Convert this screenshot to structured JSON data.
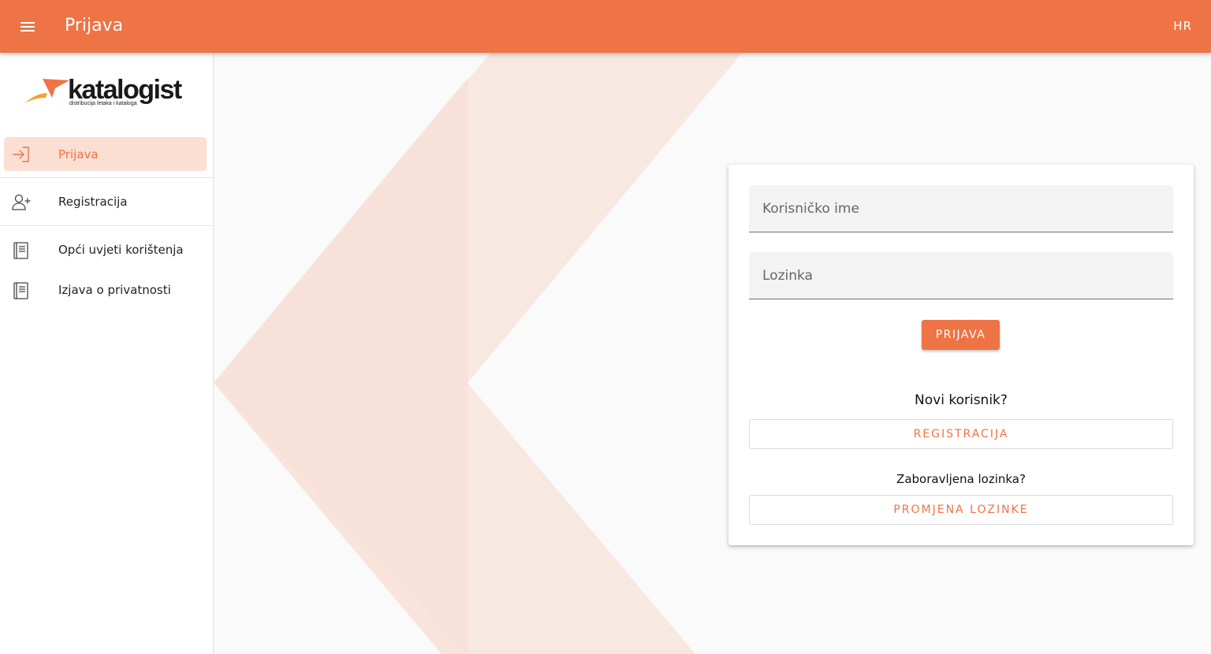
{
  "topbar": {
    "title": "Prijava",
    "language": "HR",
    "menu_icon": "menu-icon",
    "background_color": "#ee7345"
  },
  "logo": {
    "name": "katalogist",
    "tagline": "distribucija letaka i kataloga"
  },
  "sidebar": {
    "items": [
      {
        "label": "Prijava",
        "icon": "login-icon",
        "active": true
      },
      {
        "label": "Registracija",
        "icon": "add-user-icon",
        "active": false
      },
      {
        "label": "Opći uvjeti korištenja",
        "icon": "document-icon",
        "active": false
      },
      {
        "label": "Izjava o privatnosti",
        "icon": "document-icon",
        "active": false
      }
    ]
  },
  "login_form": {
    "username_placeholder": "Korisničko ime",
    "password_placeholder": "Lozinka",
    "submit_label": "PRIJAVA",
    "new_user_text": "Novi korisnik?",
    "register_label": "REGISTRACIJA",
    "forgot_password_text": "Zaboravljena lozinka?",
    "change_password_label": "PROMJENA LOZINKE"
  },
  "colors": {
    "accent": "#ee7345",
    "active_item_bg": "#fbdfd3",
    "bg_shape_light": "#f8e8e2",
    "bg_shape_dark": "#f8dfd6"
  }
}
